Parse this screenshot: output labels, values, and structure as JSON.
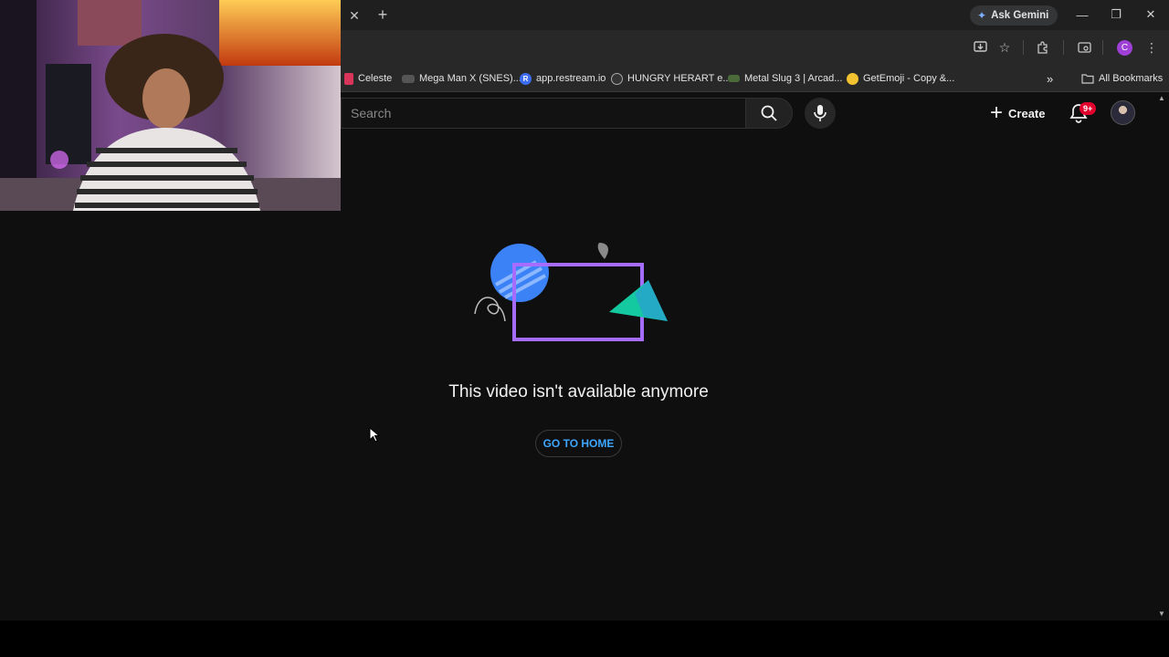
{
  "browser": {
    "ask_gemini_label": "Ask Gemini",
    "profile_initial": "C",
    "bookmarks": [
      {
        "label": "Celeste",
        "icon_color": "#d9345a"
      },
      {
        "label": "Mega Man X (SNES)...",
        "icon_color": "#555555"
      },
      {
        "label": "app.restream.io",
        "icon_color": "#3c6df0",
        "icon_text": "R"
      },
      {
        "label": "HUNGRY HERART e...",
        "icon_color": "#333333"
      },
      {
        "label": "Metal Slug 3 | Arcad...",
        "icon_color": "#4a6a3a"
      },
      {
        "label": "GetEmoji - Copy &...",
        "icon_color": "#f2c230"
      }
    ],
    "all_bookmarks_label": "All Bookmarks"
  },
  "header": {
    "search_placeholder": "Search",
    "create_label": "Create",
    "notification_badge": "9+"
  },
  "main": {
    "message": "This video isn't available anymore",
    "go_home_label": "GO TO HOME"
  },
  "colors": {
    "accent_blue": "#3ea6ff",
    "illustration_purple": "#a66cff",
    "illustration_blue": "#3b82f6",
    "illustration_green": "#14c9a0"
  }
}
